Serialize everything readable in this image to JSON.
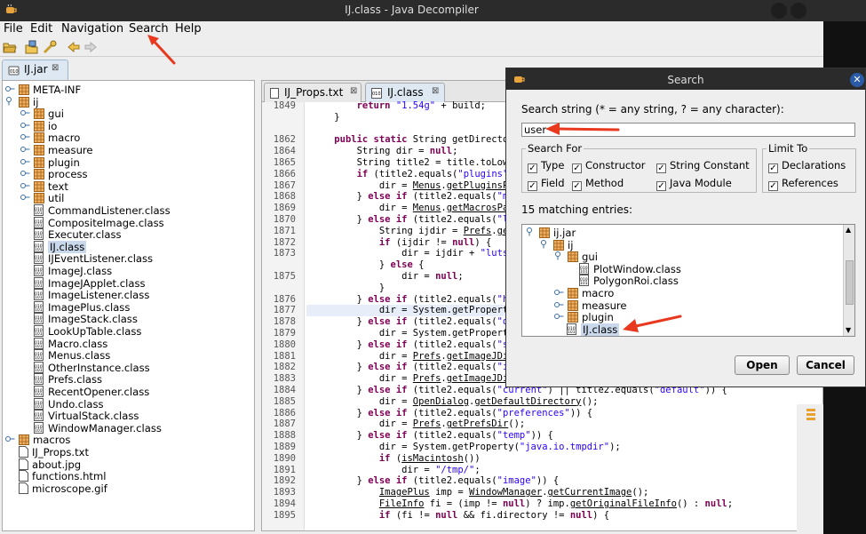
{
  "window": {
    "title": "IJ.class - Java Decompiler"
  },
  "menu": {
    "items": [
      "File",
      "Edit",
      "Navigation",
      "Search",
      "Help"
    ]
  },
  "jar_tab": {
    "label": "IJ.jar"
  },
  "tree": {
    "rows": [
      {
        "label": "META-INF",
        "kind": "pkg",
        "level": 0
      },
      {
        "label": "ij",
        "kind": "pkg",
        "level": 0
      },
      {
        "label": "gui",
        "kind": "pkg",
        "level": 1
      },
      {
        "label": "io",
        "kind": "pkg",
        "level": 1
      },
      {
        "label": "macro",
        "kind": "pkg",
        "level": 1
      },
      {
        "label": "measure",
        "kind": "pkg",
        "level": 1
      },
      {
        "label": "plugin",
        "kind": "pkg",
        "level": 1
      },
      {
        "label": "process",
        "kind": "pkg",
        "level": 1
      },
      {
        "label": "text",
        "kind": "pkg",
        "level": 1
      },
      {
        "label": "util",
        "kind": "pkg",
        "level": 1
      },
      {
        "label": "CommandListener.class",
        "kind": "cls",
        "level": 1
      },
      {
        "label": "CompositeImage.class",
        "kind": "cls",
        "level": 1
      },
      {
        "label": "Executer.class",
        "kind": "cls",
        "level": 1
      },
      {
        "label": "IJ.class",
        "kind": "cls",
        "level": 1,
        "selected": true
      },
      {
        "label": "IJEventListener.class",
        "kind": "cls",
        "level": 1
      },
      {
        "label": "ImageJ.class",
        "kind": "cls",
        "level": 1
      },
      {
        "label": "ImageJApplet.class",
        "kind": "cls",
        "level": 1
      },
      {
        "label": "ImageListener.class",
        "kind": "cls",
        "level": 1
      },
      {
        "label": "ImagePlus.class",
        "kind": "cls",
        "level": 1
      },
      {
        "label": "ImageStack.class",
        "kind": "cls",
        "level": 1
      },
      {
        "label": "LookUpTable.class",
        "kind": "cls",
        "level": 1
      },
      {
        "label": "Macro.class",
        "kind": "cls",
        "level": 1
      },
      {
        "label": "Menus.class",
        "kind": "cls",
        "level": 1
      },
      {
        "label": "OtherInstance.class",
        "kind": "cls",
        "level": 1
      },
      {
        "label": "Prefs.class",
        "kind": "cls",
        "level": 1
      },
      {
        "label": "RecentOpener.class",
        "kind": "cls",
        "level": 1
      },
      {
        "label": "Undo.class",
        "kind": "cls",
        "level": 1
      },
      {
        "label": "VirtualStack.class",
        "kind": "cls",
        "level": 1
      },
      {
        "label": "WindowManager.class",
        "kind": "cls",
        "level": 1
      },
      {
        "label": "macros",
        "kind": "pkg",
        "level": 0
      },
      {
        "label": "IJ_Props.txt",
        "kind": "file",
        "level": 0
      },
      {
        "label": "about.jpg",
        "kind": "file",
        "level": 0
      },
      {
        "label": "functions.html",
        "kind": "file",
        "level": 0
      },
      {
        "label": "microscope.gif",
        "kind": "file",
        "level": 0
      }
    ]
  },
  "editor": {
    "tabs": [
      "IJ_Props.txt",
      "IJ.class"
    ],
    "lines": [
      {
        "n": "1849",
        "segs": [
          [
            "t",
            "        "
          ],
          [
            "k",
            "return"
          ],
          [
            "t",
            " "
          ],
          [
            "s",
            "\"1.54g\""
          ],
          [
            "t",
            " + build;"
          ]
        ]
      },
      {
        "n": "",
        "segs": [
          [
            "t",
            "    }"
          ]
        ]
      },
      {
        "n": "",
        "segs": [
          [
            "t",
            ""
          ]
        ]
      },
      {
        "n": "1862",
        "segs": [
          [
            "t",
            "    "
          ],
          [
            "k",
            "public static"
          ],
          [
            "t",
            " String getDirectory(St"
          ]
        ]
      },
      {
        "n": "1864",
        "segs": [
          [
            "t",
            "        String dir = "
          ],
          [
            "k",
            "null"
          ],
          [
            "t",
            ";"
          ]
        ]
      },
      {
        "n": "1865",
        "segs": [
          [
            "t",
            "        String title2 = title.toLowerCase("
          ]
        ]
      },
      {
        "n": "1866",
        "segs": [
          [
            "t",
            "        "
          ],
          [
            "k",
            "if"
          ],
          [
            "t",
            " (title2.equals("
          ],
          [
            "s",
            "\"plugins\""
          ],
          [
            "t",
            ")) {"
          ]
        ]
      },
      {
        "n": "1867",
        "segs": [
          [
            "t",
            "            dir = "
          ],
          [
            "u",
            "Menus"
          ],
          [
            "t",
            "."
          ],
          [
            "u",
            "getPluginsPath"
          ],
          [
            "t",
            "();"
          ]
        ]
      },
      {
        "n": "1868",
        "segs": [
          [
            "t",
            "        } "
          ],
          [
            "k",
            "else if"
          ],
          [
            "t",
            " (title2.equals("
          ],
          [
            "s",
            "\"macros\""
          ],
          [
            "t",
            ")"
          ]
        ]
      },
      {
        "n": "1869",
        "segs": [
          [
            "t",
            "            dir = "
          ],
          [
            "u",
            "Menus"
          ],
          [
            "t",
            "."
          ],
          [
            "u",
            "getMacrosPath"
          ],
          [
            "t",
            "();"
          ]
        ]
      },
      {
        "n": "1870",
        "segs": [
          [
            "t",
            "        } "
          ],
          [
            "k",
            "else if"
          ],
          [
            "t",
            " (title2.equals("
          ],
          [
            "s",
            "\"luts\""
          ],
          [
            "t",
            ")) -"
          ]
        ]
      },
      {
        "n": "1871",
        "segs": [
          [
            "t",
            "            String ijdir = "
          ],
          [
            "u",
            "Prefs"
          ],
          [
            "t",
            "."
          ],
          [
            "u",
            "getImageJDi"
          ]
        ]
      },
      {
        "n": "1872",
        "segs": [
          [
            "t",
            "            "
          ],
          [
            "k",
            "if"
          ],
          [
            "t",
            " (ijdir != "
          ],
          [
            "k",
            "null"
          ],
          [
            "t",
            ") {"
          ]
        ]
      },
      {
        "n": "1873",
        "segs": [
          [
            "t",
            "                dir = ijdir + "
          ],
          [
            "s",
            "\"luts\""
          ],
          [
            "t",
            " + File.sep"
          ]
        ]
      },
      {
        "n": "",
        "segs": [
          [
            "t",
            "            } "
          ],
          [
            "k",
            "else"
          ],
          [
            "t",
            " {"
          ]
        ]
      },
      {
        "n": "1875",
        "segs": [
          [
            "t",
            "                dir = "
          ],
          [
            "k",
            "null"
          ],
          [
            "t",
            ";"
          ]
        ]
      },
      {
        "n": "",
        "segs": [
          [
            "t",
            "            }"
          ]
        ]
      },
      {
        "n": "1876",
        "segs": [
          [
            "t",
            "        } "
          ],
          [
            "k",
            "else if"
          ],
          [
            "t",
            " (title2.equals("
          ],
          [
            "s",
            "\"home\""
          ],
          [
            "t",
            ")) -"
          ]
        ]
      },
      {
        "n": "1877",
        "segs": [
          [
            "t",
            "            dir = System.getProperty("
          ],
          [
            "s",
            "\""
          ],
          [
            "h",
            "user"
          ],
          [
            "s",
            ".h"
          ]
        ]
      },
      {
        "n": "1878",
        "segs": [
          [
            "t",
            "        } "
          ],
          [
            "k",
            "else if"
          ],
          [
            "t",
            " (title2.equals("
          ],
          [
            "s",
            "\"downloa"
          ]
        ]
      },
      {
        "n": "1879",
        "segs": [
          [
            "t",
            "            dir = System.getProperty("
          ],
          [
            "s",
            "\""
          ],
          [
            "h",
            "user"
          ],
          [
            "s",
            ".h"
          ]
        ]
      },
      {
        "n": "1880",
        "segs": [
          [
            "t",
            "        } "
          ],
          [
            "k",
            "else if"
          ],
          [
            "t",
            " (title2.equals("
          ],
          [
            "s",
            "\"startup\""
          ]
        ]
      },
      {
        "n": "1881",
        "segs": [
          [
            "t",
            "            dir = "
          ],
          [
            "u",
            "Prefs"
          ],
          [
            "t",
            "."
          ],
          [
            "u",
            "getImageJDir"
          ],
          [
            "t",
            "();"
          ]
        ]
      },
      {
        "n": "1882",
        "segs": [
          [
            "t",
            "        } "
          ],
          [
            "k",
            "else if"
          ],
          [
            "t",
            " (title2.equals("
          ],
          [
            "s",
            "\"imagej\""
          ],
          [
            "t",
            ")"
          ]
        ]
      },
      {
        "n": "1883",
        "segs": [
          [
            "t",
            "            dir = "
          ],
          [
            "u",
            "Prefs"
          ],
          [
            "t",
            "."
          ],
          [
            "u",
            "getImageJDir"
          ],
          [
            "t",
            "();"
          ]
        ]
      },
      {
        "n": "1884",
        "segs": [
          [
            "t",
            "        } "
          ],
          [
            "k",
            "else if"
          ],
          [
            "t",
            " (title2.equals("
          ],
          [
            "s",
            "\"current\""
          ],
          [
            "t",
            ") || title2.equals("
          ],
          [
            "s",
            "\"default\""
          ],
          [
            "t",
            ")) {"
          ]
        ]
      },
      {
        "n": "1885",
        "segs": [
          [
            "t",
            "            dir = "
          ],
          [
            "u",
            "OpenDialog"
          ],
          [
            "t",
            "."
          ],
          [
            "u",
            "getDefaultDirectory"
          ],
          [
            "t",
            "();"
          ]
        ]
      },
      {
        "n": "1886",
        "segs": [
          [
            "t",
            "        } "
          ],
          [
            "k",
            "else if"
          ],
          [
            "t",
            " (title2.equals("
          ],
          [
            "s",
            "\"preferences\""
          ],
          [
            "t",
            ")) {"
          ]
        ]
      },
      {
        "n": "1887",
        "segs": [
          [
            "t",
            "            dir = "
          ],
          [
            "u",
            "Prefs"
          ],
          [
            "t",
            "."
          ],
          [
            "u",
            "getPrefsDir"
          ],
          [
            "t",
            "();"
          ]
        ]
      },
      {
        "n": "1888",
        "segs": [
          [
            "t",
            "        } "
          ],
          [
            "k",
            "else if"
          ],
          [
            "t",
            " (title2.equals("
          ],
          [
            "s",
            "\"temp\""
          ],
          [
            "t",
            ")) {"
          ]
        ]
      },
      {
        "n": "1889",
        "segs": [
          [
            "t",
            "            dir = System.getProperty("
          ],
          [
            "s",
            "\"java.io.tmpdir\""
          ],
          [
            "t",
            ");"
          ]
        ]
      },
      {
        "n": "1890",
        "segs": [
          [
            "t",
            "            "
          ],
          [
            "k",
            "if"
          ],
          [
            "t",
            " ("
          ],
          [
            "u",
            "isMacintosh"
          ],
          [
            "t",
            "())"
          ]
        ]
      },
      {
        "n": "1891",
        "segs": [
          [
            "t",
            "                dir = "
          ],
          [
            "s",
            "\"/tmp/\""
          ],
          [
            "t",
            ";"
          ]
        ]
      },
      {
        "n": "1892",
        "segs": [
          [
            "t",
            "        } "
          ],
          [
            "k",
            "else if"
          ],
          [
            "t",
            " (title2.equals("
          ],
          [
            "s",
            "\"image\""
          ],
          [
            "t",
            ")) {"
          ]
        ]
      },
      {
        "n": "1893",
        "segs": [
          [
            "t",
            "            "
          ],
          [
            "u",
            "ImagePlus"
          ],
          [
            "t",
            " imp = "
          ],
          [
            "u",
            "WindowManager"
          ],
          [
            "t",
            "."
          ],
          [
            "u",
            "getCurrentImage"
          ],
          [
            "t",
            "();"
          ]
        ]
      },
      {
        "n": "1894",
        "segs": [
          [
            "t",
            "            "
          ],
          [
            "u",
            "FileInfo"
          ],
          [
            "t",
            " fi = (imp != "
          ],
          [
            "k",
            "null"
          ],
          [
            "t",
            ") ? imp."
          ],
          [
            "u",
            "getOriginalFileInfo"
          ],
          [
            "t",
            "() : "
          ],
          [
            "k",
            "null"
          ],
          [
            "t",
            ";"
          ]
        ]
      },
      {
        "n": "1895",
        "segs": [
          [
            "t",
            "            "
          ],
          [
            "k",
            "if"
          ],
          [
            "t",
            " (fi != "
          ],
          [
            "k",
            "null"
          ],
          [
            "t",
            " && fi.directory != "
          ],
          [
            "k",
            "null"
          ],
          [
            "t",
            ") {"
          ]
        ]
      }
    ]
  },
  "dialog": {
    "title": "Search",
    "search_label": "Search string (* = any string, ? = any character):",
    "search_value": "user",
    "search_for_label": "Search For",
    "limit_to_label": "Limit To",
    "checks": [
      "Type",
      "Constructor",
      "String Constant",
      "Field",
      "Method",
      "Java Module"
    ],
    "limits": [
      "Declarations",
      "References"
    ],
    "matches_label": "15 matching entries:",
    "results": [
      {
        "label": "ij.jar",
        "kind": "jar"
      },
      {
        "label": "ij",
        "kind": "pkg"
      },
      {
        "label": "gui",
        "kind": "pkg"
      },
      {
        "label": "PlotWindow.class",
        "kind": "cls"
      },
      {
        "label": "PolygonRoi.class",
        "kind": "cls"
      },
      {
        "label": "macro",
        "kind": "pkg"
      },
      {
        "label": "measure",
        "kind": "pkg"
      },
      {
        "label": "plugin",
        "kind": "pkg"
      },
      {
        "label": "IJ.class",
        "kind": "cls",
        "selected": true
      }
    ],
    "open_label": "Open",
    "cancel_label": "Cancel"
  },
  "colors": {
    "annotation_arrow": "#e8391f",
    "selection": "#c9d8ea",
    "highlight": "#f2a33c",
    "keyword": "#7f0055",
    "string": "#2a00ff"
  }
}
